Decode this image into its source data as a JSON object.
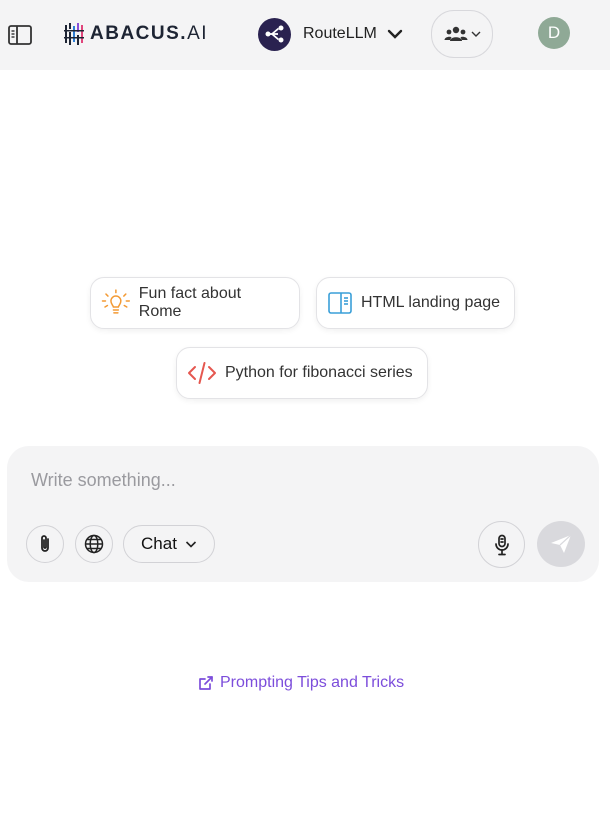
{
  "header": {
    "logo_text": "ABACUS.",
    "logo_suffix": "AI",
    "model_label": "RouteLLM",
    "avatar_initial": "D"
  },
  "suggestions": [
    {
      "label": "Fun fact about Rome",
      "icon": "lightbulb-icon",
      "color": "#f39a34"
    },
    {
      "label": "HTML landing page",
      "icon": "layout-icon",
      "color": "#3a9fd8"
    },
    {
      "label": "Python for fibonacci series",
      "icon": "code-icon",
      "color": "#e5574f"
    }
  ],
  "composer": {
    "placeholder": "Write something...",
    "mode_label": "Chat"
  },
  "footer": {
    "tips_label": "Prompting Tips and Tricks",
    "link_color": "#7c4ddb"
  }
}
